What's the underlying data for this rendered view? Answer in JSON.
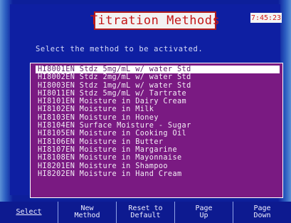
{
  "window": {
    "title": "Titration Methods",
    "clock": "7:45:23"
  },
  "prompt": "Select the method to be activated.",
  "methods": [
    "HI8001EN Stdz 5mg/mL w/ water Std",
    "HI8002EN Stdz 2mg/mL w/ water Std",
    "HI8003EN Stdz 1mg/mL w/ water Std",
    "HI8011EN Stdz 5mg/mL w/ Tartrate",
    "HI8101EN Moisture in Dairy Cream",
    "HI8102EN Moisture in Milk",
    "HI8103EN Moisture in Honey",
    "HI8104EN Surface Moisture - Sugar",
    "HI8105EN Moisture in Cooking Oil",
    "HI8106EN Moisture in Butter",
    "HI8107EN Moisture in Margarine",
    "HI8108EN Moisture in Mayonnaise",
    "HI8201EN Moisture in Shampoo",
    "HI8202EN Moisture in Hand Cream"
  ],
  "selected_index": 0,
  "buttons": {
    "select": "Select",
    "new_method_1": "New",
    "new_method_2": "Method",
    "reset_1": "Reset to",
    "reset_2": "Default",
    "page_up_1": "Page",
    "page_up_2": "Up",
    "page_down_1": "Page",
    "page_down_2": "Down"
  },
  "colors": {
    "screen_background": "#0e1fa2",
    "list_background": "#7a1a82",
    "title_text": "#c41616",
    "selection_highlight": "#ffffff"
  }
}
